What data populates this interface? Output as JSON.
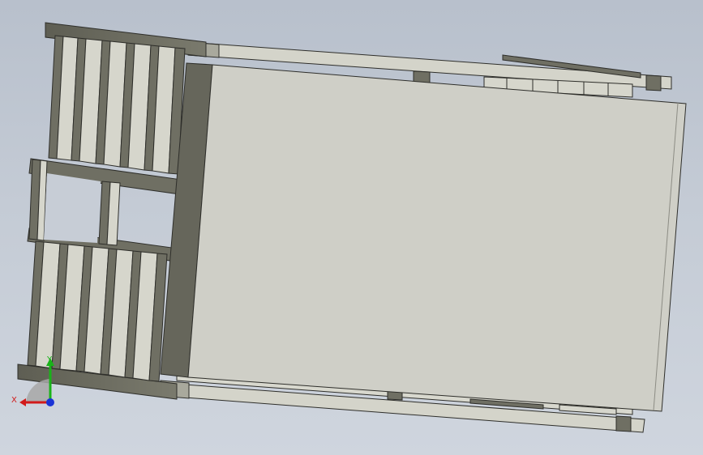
{
  "viewport": {
    "background_top": "#b8c0cc",
    "background_bottom": "#cfd5de"
  },
  "model": {
    "colors": {
      "panel": "#cfcfc7",
      "panel_edge": "#3c3c36",
      "frame_dark": "#6f6f63",
      "frame_light": "#d6d6cc",
      "rail": "#d2d2c8",
      "line": "#2e2e2a"
    }
  },
  "triad": {
    "x_label": "X",
    "y_label": "Y",
    "x_color": "#d11a1a",
    "y_color": "#19b319",
    "z_color": "#1a33d6"
  }
}
